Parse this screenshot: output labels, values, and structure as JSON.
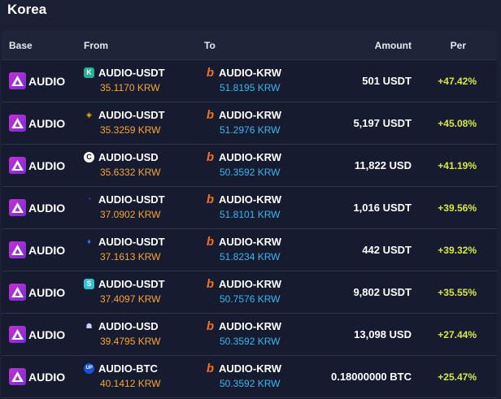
{
  "section": {
    "title": "Korea"
  },
  "table": {
    "headers": {
      "base": "Base",
      "from": "From",
      "to": "To",
      "amount": "Amount",
      "per": "Per"
    },
    "rows": [
      {
        "base": "AUDIO",
        "from_exchange_icon": "kucoin-icon",
        "from_pair": "AUDIO-USDT",
        "from_price": "35.1170 KRW",
        "to_exchange_icon": "bithumb-icon",
        "to_pair": "AUDIO-KRW",
        "to_price": "51.8195 KRW",
        "amount": "501 USDT",
        "per": "+47.42%"
      },
      {
        "base": "AUDIO",
        "from_exchange_icon": "binance-icon",
        "from_pair": "AUDIO-USDT",
        "from_price": "35.3259 KRW",
        "to_exchange_icon": "bithumb-icon",
        "to_pair": "AUDIO-KRW",
        "to_price": "51.2976 KRW",
        "amount": "5,197 USDT",
        "per": "+45.08%"
      },
      {
        "base": "AUDIO",
        "from_exchange_icon": "coinbase-icon",
        "from_pair": "AUDIO-USD",
        "from_price": "35.6332 KRW",
        "to_exchange_icon": "bithumb-icon",
        "to_pair": "AUDIO-KRW",
        "to_price": "50.3592 KRW",
        "amount": "11,822 USD",
        "per": "+41.19%"
      },
      {
        "base": "AUDIO",
        "from_exchange_icon": "gate-icon",
        "from_pair": "AUDIO-USDT",
        "from_price": "37.0902 KRW",
        "to_exchange_icon": "bithumb-icon",
        "to_pair": "AUDIO-KRW",
        "to_price": "51.8101 KRW",
        "amount": "1,016 USDT",
        "per": "+39.56%"
      },
      {
        "base": "AUDIO",
        "from_exchange_icon": "huobi-icon",
        "from_pair": "AUDIO-USDT",
        "from_price": "37.1613 KRW",
        "to_exchange_icon": "bithumb-icon",
        "to_pair": "AUDIO-KRW",
        "to_price": "51.8234 KRW",
        "amount": "442 USDT",
        "per": "+39.32%"
      },
      {
        "base": "AUDIO",
        "from_exchange_icon": "bybit-icon",
        "from_pair": "AUDIO-USDT",
        "from_price": "37.4097 KRW",
        "to_exchange_icon": "bithumb-icon",
        "to_pair": "AUDIO-KRW",
        "to_price": "50.7576 KRW",
        "amount": "9,802 USDT",
        "per": "+35.55%"
      },
      {
        "base": "AUDIO",
        "from_exchange_icon": "kraken-icon",
        "from_pair": "AUDIO-USD",
        "from_price": "39.4795 KRW",
        "to_exchange_icon": "bithumb-icon",
        "to_pair": "AUDIO-KRW",
        "to_price": "50.3592 KRW",
        "amount": "13,098 USD",
        "per": "+27.44%"
      },
      {
        "base": "AUDIO",
        "from_exchange_icon": "upbit-icon",
        "from_pair": "AUDIO-BTC",
        "from_price": "40.1412 KRW",
        "to_exchange_icon": "bithumb-icon",
        "to_pair": "AUDIO-KRW",
        "to_price": "50.3592 KRW",
        "amount": "0.18000000 BTC",
        "per": "+25.47%"
      }
    ]
  },
  "colors": {
    "from_price": "#f7a531",
    "to_price": "#35b9f0",
    "per": "#d9e83a",
    "audio_brand": "#c42fd8",
    "bithumb": "#f37021"
  }
}
